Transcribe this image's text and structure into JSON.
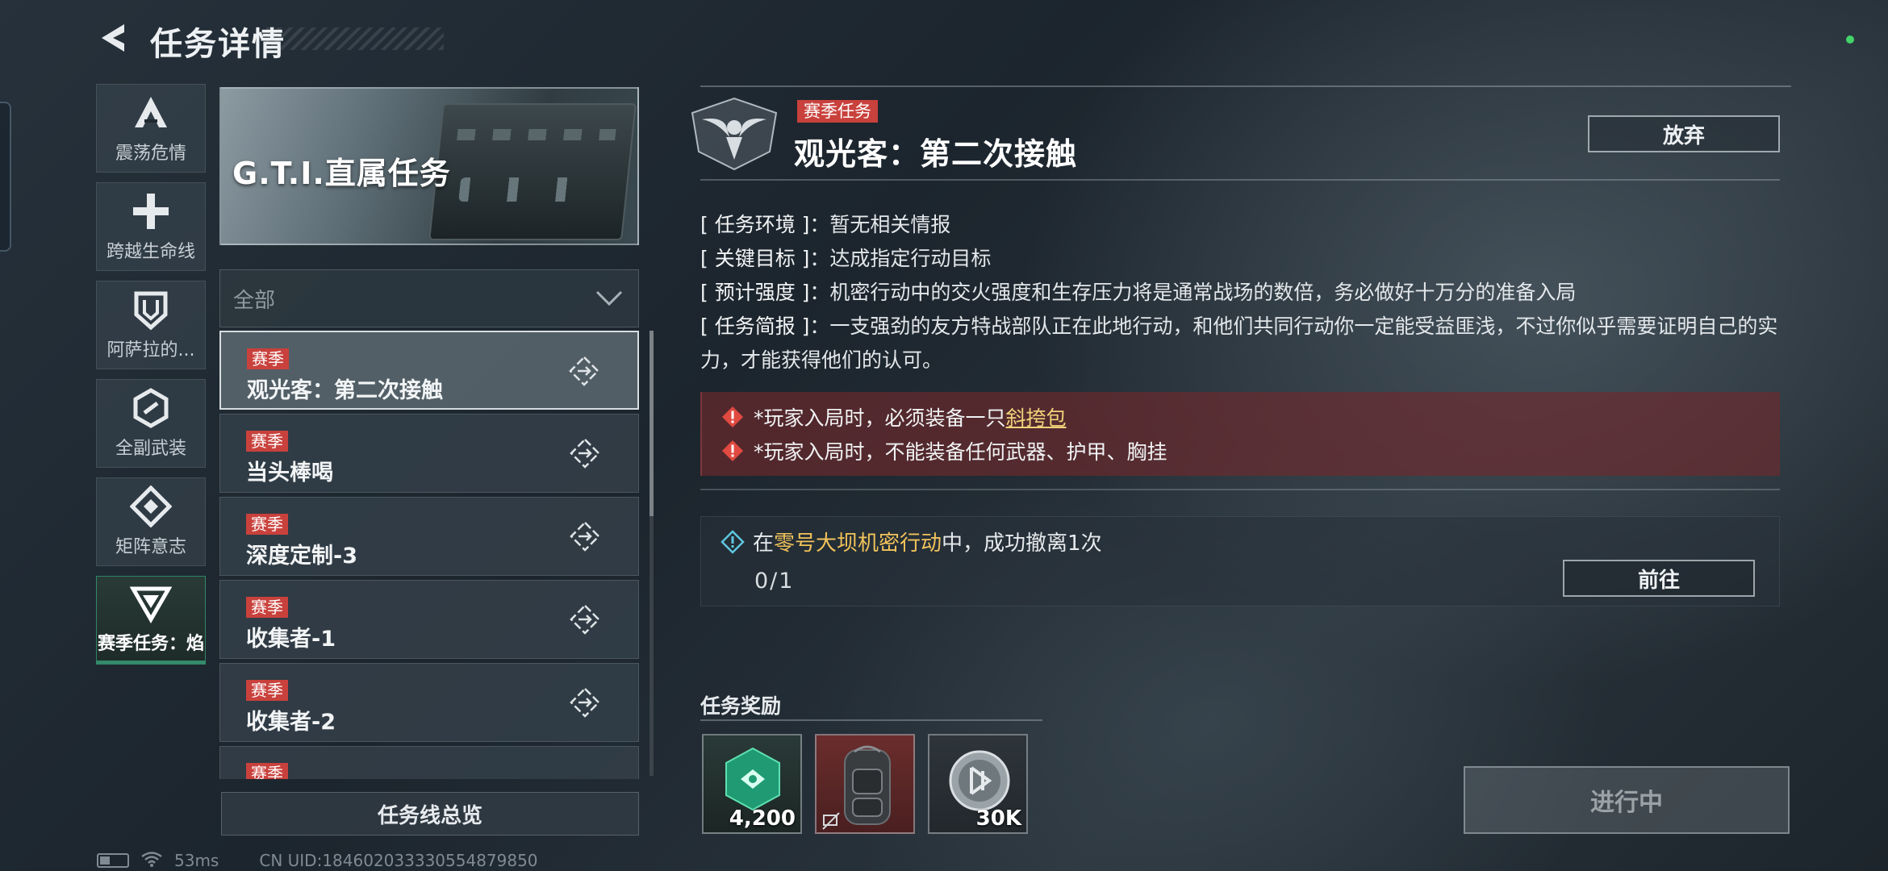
{
  "header": {
    "title": "任务详情"
  },
  "categories": [
    {
      "label": "震荡危情",
      "icon": "a-chevron-icon"
    },
    {
      "label": "跨越生命线",
      "icon": "plus-cross-icon"
    },
    {
      "label": "阿萨拉的...",
      "icon": "shield-icon"
    },
    {
      "label": "全副武装",
      "icon": "hex-link-icon"
    },
    {
      "label": "矩阵意志",
      "icon": "diamond-icon"
    },
    {
      "label": "赛季任务：焰",
      "icon": "season-v-icon",
      "active": true
    }
  ],
  "banner": {
    "title": "G.T.I.直属任务"
  },
  "filter": {
    "value": "全部"
  },
  "tasks": [
    {
      "tag": "赛季",
      "name": "观光客：第二次接触",
      "selected": true
    },
    {
      "tag": "赛季",
      "name": "当头棒喝"
    },
    {
      "tag": "赛季",
      "name": "深度定制-3"
    },
    {
      "tag": "赛季",
      "name": "收集者-1"
    },
    {
      "tag": "赛季",
      "name": "收集者-2"
    },
    {
      "tag": "赛季",
      "name": ""
    }
  ],
  "overview_button": "任务线总览",
  "footer": {
    "ping": "53ms",
    "uid": "CN UID:184602033330554879850"
  },
  "detail": {
    "badge": "赛季任务",
    "title": "观光客：第二次接触",
    "abandon": "放弃",
    "info": [
      {
        "key": "[ 任务环境 ]",
        "value": "暂无相关情报"
      },
      {
        "key": "[ 关键目标 ]",
        "value": "达成指定行动目标"
      },
      {
        "key": "[ 预计强度 ]",
        "value": "机密行动中的交火强度和生存压力将是通常战场的数倍，务必做好十万分的准备入局"
      },
      {
        "key": "[ 任务简报 ]",
        "value": "一支强劲的友方特战部队正在此地行动，和他们共同行动你一定能受益匪浅，不过你似乎需要证明自己的实力，才能获得他们的认可。"
      }
    ],
    "warnings": {
      "w1_prefix": "*玩家入局时，必须装备一只",
      "w1_link": "斜挎包",
      "w2": "*玩家入局时，不能装备任何武器、护甲、胸挂"
    },
    "objective": {
      "prefix": "在",
      "highlight": "零号大坝机密行动",
      "suffix": "中，成功撤离1次",
      "progress": "0/1",
      "goto": "前往"
    },
    "rewards_title": "任务奖励",
    "rewards": [
      {
        "qty": "4,200",
        "icon": "exp-chip-icon"
      },
      {
        "qty": "",
        "icon": "backpack-icon"
      },
      {
        "qty": "30K",
        "icon": "coin-icon"
      }
    ],
    "status_button": "进行中"
  },
  "colors": {
    "accent": "#3fd9a0",
    "season_tag": "#c9413c",
    "highlight": "#f2c35a",
    "warning_bg": "#6e2a2c"
  }
}
